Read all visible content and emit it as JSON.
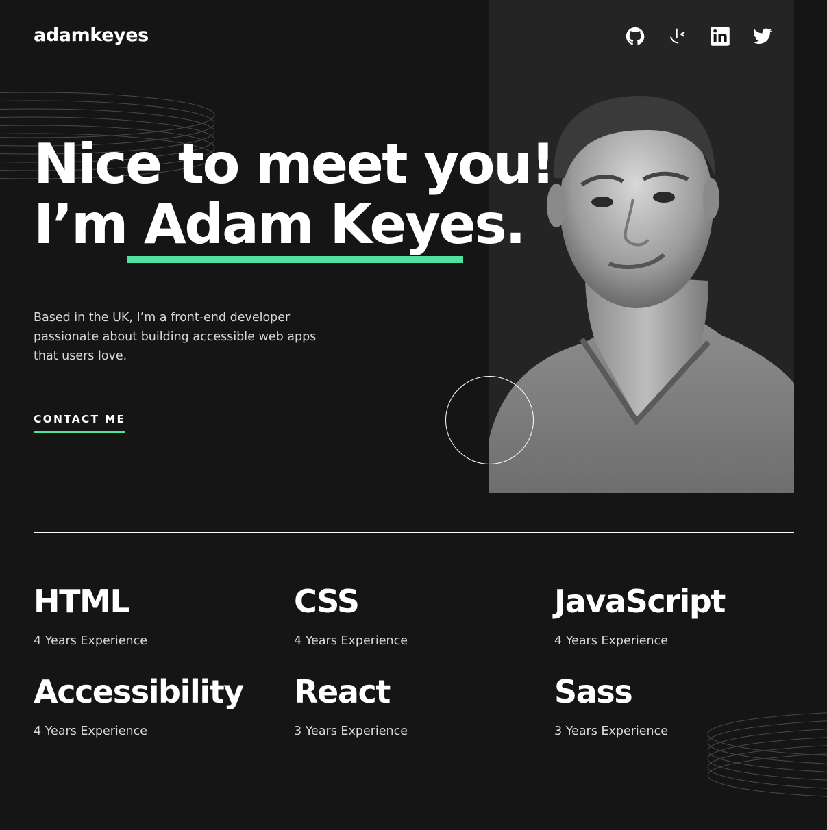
{
  "header": {
    "logo": "adamkeyes",
    "socials": [
      {
        "icon": "github-icon"
      },
      {
        "icon": "frontend-mentor-icon"
      },
      {
        "icon": "linkedin-icon"
      },
      {
        "icon": "twitter-icon"
      }
    ]
  },
  "hero": {
    "headline_line1": "Nice to meet you!",
    "headline_prefix": "I’m ",
    "headline_name": "Adam Keyes.",
    "intro": "Based in the UK, I’m a front-end developer passionate about building accessible web apps that users love.",
    "cta_label": "CONTACT ME"
  },
  "skills": [
    {
      "name": "HTML",
      "experience": "4 Years Experience"
    },
    {
      "name": "CSS",
      "experience": "4 Years Experience"
    },
    {
      "name": "JavaScript",
      "experience": "4 Years Experience"
    },
    {
      "name": "Accessibility",
      "experience": "4 Years Experience"
    },
    {
      "name": "React",
      "experience": "3 Years Experience"
    },
    {
      "name": "Sass",
      "experience": "3 Years Experience"
    }
  ],
  "colors": {
    "background": "#151515",
    "panel": "#242424",
    "accent": "#4ee1a0",
    "text": "#ffffff",
    "muted": "#d9d9d9"
  }
}
